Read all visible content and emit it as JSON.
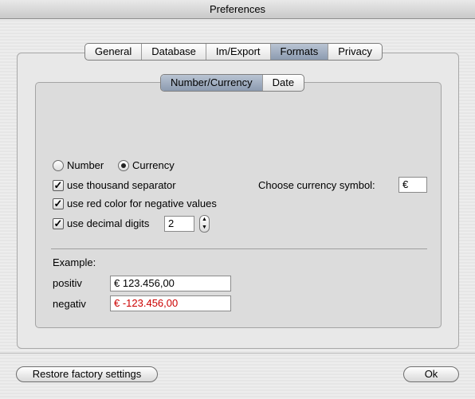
{
  "window": {
    "title": "Preferences"
  },
  "outer_tabs": [
    {
      "label": "General",
      "selected": false
    },
    {
      "label": "Database",
      "selected": false
    },
    {
      "label": "Im/Export",
      "selected": false
    },
    {
      "label": "Formats",
      "selected": true
    },
    {
      "label": "Privacy",
      "selected": false
    }
  ],
  "inner_tabs": [
    {
      "label": "Number/Currency",
      "selected": true
    },
    {
      "label": "Date",
      "selected": false
    }
  ],
  "format": {
    "number_label": "Number",
    "currency_label": "Currency",
    "selected": "Currency",
    "thousand_separator_label": "use thousand separator",
    "thousand_separator_checked": true,
    "red_negative_label": "use red color for negative values",
    "red_negative_checked": true,
    "decimal_digits_label": "use decimal digits",
    "decimal_digits_checked": true,
    "decimal_digits_value": "2",
    "currency_symbol_label": "Choose currency symbol:",
    "currency_symbol_value": "€",
    "check_mark": "✓",
    "stepper_up": "▲",
    "stepper_down": "▼"
  },
  "example": {
    "heading": "Example:",
    "positive_label": "positiv",
    "positive_value": "€ 123.456,00",
    "negative_label": "negativ",
    "negative_value": "€ -123.456,00",
    "negative_color": "#cc0000"
  },
  "buttons": {
    "restore_label": "Restore factory settings",
    "ok_label": "Ok"
  }
}
